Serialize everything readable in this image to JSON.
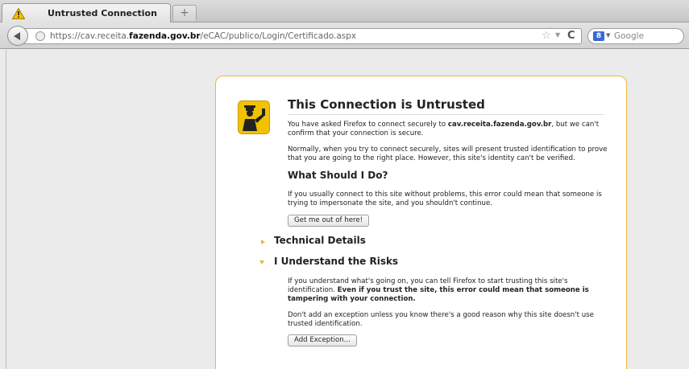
{
  "tab": {
    "title": "Untrusted Connection",
    "new_tab_label": "+"
  },
  "navbar": {
    "url_prefix": "https://cav.receita.",
    "url_domain": "fazenda.gov.br",
    "url_path": "/eCAC/publico/Login/Certificado.aspx",
    "search_engine_icon": "8",
    "search_placeholder": "Google"
  },
  "page": {
    "title": "This Connection is Untrusted",
    "intro_before": "You have asked Firefox to connect securely to ",
    "intro_host": "cav.receita.fazenda.gov.br",
    "intro_after": ", but we can't confirm that your connection is secure.",
    "normally": "Normally, when you try to connect securely, sites will present trusted identification to prove that you are going to the right place. However, this site's identity can't be verified.",
    "what_heading": "What Should I Do?",
    "what_text": "If you usually connect to this site without problems, this error could mean that someone is trying to impersonate the site, and you shouldn't continue.",
    "get_out_button": "Get me out of here!",
    "technical_details": "Technical Details",
    "understand_risks": "I Understand the Risks",
    "risks_text_1": "If you understand what's going on, you can tell Firefox to start trusting this site's identification. ",
    "risks_text_bold": "Even if you trust the site, this error could mean that someone is tampering with your connection.",
    "exception_text": "Don't add an exception unless you know there's a good reason why this site doesn't use trusted identification.",
    "add_exception_button": "Add Exception..."
  },
  "colors": {
    "accent": "#f0b63b",
    "warning": "#f2c200"
  },
  "icons": {
    "tab_warning": "warning-icon",
    "back": "back-arrow-icon",
    "site_identity": "globe-icon",
    "bookmark": "star-icon",
    "reload": "reload-icon",
    "search_engine": "google-icon",
    "page": "police-officer-icon"
  }
}
